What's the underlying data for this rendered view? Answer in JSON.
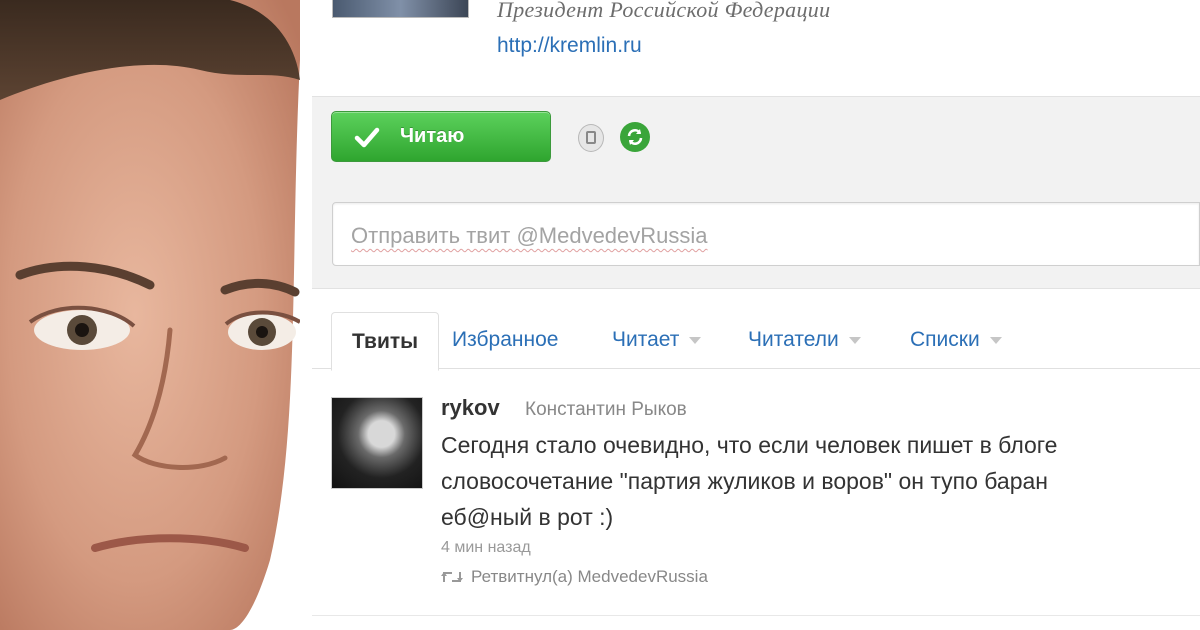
{
  "profile": {
    "bio": "Президент Российской Федерации",
    "url": "http://kremlin.ru"
  },
  "actions": {
    "follow_label": "Читаю"
  },
  "compose": {
    "placeholder": "Отправить твит @MedvedevRussia"
  },
  "tabs": [
    {
      "label": "Твиты",
      "active": true
    },
    {
      "label": "Избранное"
    },
    {
      "label": "Читает"
    },
    {
      "label": "Читатели"
    },
    {
      "label": "Списки"
    }
  ],
  "tweet": {
    "username": "rykov",
    "fullname": "Константин Рыков",
    "text": "Сегодня стало очевидно, что если человек пишет в блоге\nсловосочетание \"партия жуликов и воров\" он тупо баран\nеб@ный в рот :)",
    "time": "4 мин назад",
    "retweeted_by": "Ретвитнул(а) MedvedevRussia"
  },
  "colors": {
    "link": "#2b6fb6",
    "follow_button": "#3aa53a"
  }
}
